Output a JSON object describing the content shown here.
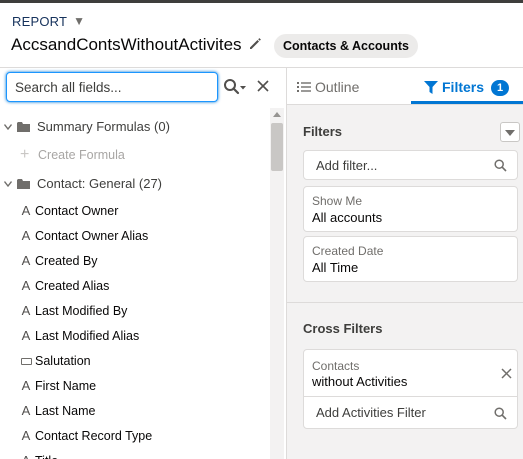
{
  "header": {
    "report_label": "REPORT",
    "report_name": "AccsandContsWithoutActivites",
    "report_type": "Contacts & Accounts"
  },
  "field_panel": {
    "search_placeholder": "Search all fields...",
    "groups": [
      {
        "label": "Summary Formulas (0)",
        "create_label": "Create Formula"
      },
      {
        "label": "Contact: General (27)"
      }
    ],
    "fields": [
      {
        "label": "Contact Owner",
        "type_icon": "text-type-icon"
      },
      {
        "label": "Contact Owner Alias",
        "type_icon": "text-type-icon"
      },
      {
        "label": "Created By",
        "type_icon": "text-type-icon"
      },
      {
        "label": "Created Alias",
        "type_icon": "text-type-icon"
      },
      {
        "label": "Last Modified By",
        "type_icon": "text-type-icon"
      },
      {
        "label": "Last Modified Alias",
        "type_icon": "text-type-icon"
      },
      {
        "label": "Salutation",
        "type_icon": "picklist-type-icon"
      },
      {
        "label": "First Name",
        "type_icon": "text-type-icon"
      },
      {
        "label": "Last Name",
        "type_icon": "text-type-icon"
      },
      {
        "label": "Contact Record Type",
        "type_icon": "text-type-icon"
      },
      {
        "label": "Title",
        "type_icon": "text-type-icon"
      }
    ],
    "text_type_glyph": "A"
  },
  "tabs": {
    "outline_label": "Outline",
    "filters_label": "Filters",
    "filters_badge": "1",
    "active": "filters"
  },
  "filters": {
    "section_title": "Filters",
    "add_filter_placeholder": "Add filter...",
    "items": [
      {
        "label": "Show Me",
        "value": "All accounts"
      },
      {
        "label": "Created Date",
        "value": "All Time"
      }
    ]
  },
  "cross_filters": {
    "section_title": "Cross Filters",
    "item": {
      "label": "Contacts",
      "value": "without Activities"
    },
    "add_label": "Add Activities Filter"
  },
  "colors": {
    "accent": "#0176d3",
    "panel_bg": "#f3f2f2",
    "pill_bg": "#ecebea"
  }
}
